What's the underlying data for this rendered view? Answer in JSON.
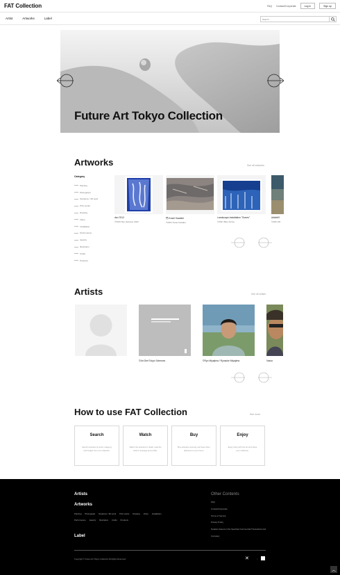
{
  "header": {
    "logo": "FAT Collection",
    "links": [
      "FAQ",
      "Contact/Corporate"
    ],
    "login": "Log in",
    "register": "Sign up"
  },
  "nav": {
    "items": [
      "Artist",
      "Artworks",
      "Label"
    ],
    "search_placeholder": "Search"
  },
  "hero": {
    "title": "Future Art Tokyo Collection"
  },
  "artworks": {
    "title": "Artworks",
    "see_all": "See all artworks",
    "categories_title": "Category",
    "categories": [
      "Painting",
      "Photograph",
      "Sculpture / 3D work",
      "Print works",
      "Drawing",
      "Video",
      "Installation",
      "Performance",
      "Jewelry",
      "Illustration",
      "Crafts",
      "Products"
    ],
    "items": [
      {
        "caption": "dsn:7512",
        "sub": "©2019 Ryo Hamano 2022"
      },
      {
        "caption": "門-Kosei Kawabe",
        "sub": "©2021 Kosei Kawabe"
      },
      {
        "caption": "Landscape-Installation \"Dunes\"",
        "sub": "©2021 Blue Series"
      },
      {
        "caption": "#####/0",
        "sub": "©2021 ##"
      }
    ]
  },
  "artists": {
    "title": "Artists",
    "see_all": "See all artists",
    "items": [
      {
        "name": ""
      },
      {
        "name": "©Art Diet Tokyo Sciences"
      },
      {
        "name": "©Ryo Miyajima / Ryosuke Miyajima"
      },
      {
        "name": "Vasco"
      }
    ]
  },
  "howto": {
    "title": "How to use FAT Collection",
    "see_all": "See more",
    "cards": [
      {
        "title": "Search",
        "desc": "Search artworks by artist, category and budget from our collection."
      },
      {
        "title": "Watch",
        "desc": "Watch the artworks in detail, read the artist's message and profile."
      },
      {
        "title": "Buy",
        "desc": "Buy artworks securely and have them delivered to your home."
      },
      {
        "title": "Enjoy",
        "desc": "Enjoy living with the art and share your collection."
      }
    ]
  },
  "footer": {
    "artists": "Artists",
    "artworks": "Artworks",
    "label": "Label",
    "categories": [
      "Painting",
      "Photograph",
      "Sculpture / 3D work",
      "Print works",
      "Drawing",
      "Video",
      "Installation",
      "Performance",
      "Jewelry",
      "Illustration",
      "Crafts",
      "Products"
    ],
    "other_title": "Other Contents",
    "other_links": [
      "FAQ",
      "Contact/Corporate",
      "Terms of Service",
      "Privacy Policy",
      "Notation based on the Specified Commercial Transactions Act",
      "Company"
    ],
    "copyright": "Copyright © Future Art Tokyo Collection All Rights Reserved."
  }
}
